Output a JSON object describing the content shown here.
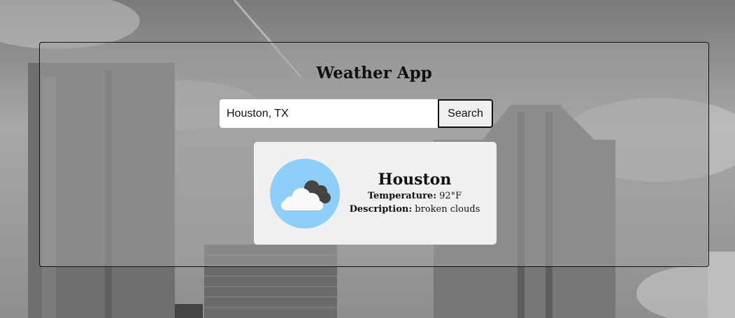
{
  "app": {
    "title": "Weather App"
  },
  "search": {
    "value": "Houston, TX",
    "button_label": "Search"
  },
  "weather": {
    "icon": "broken-clouds-icon",
    "city": "Houston",
    "temperature_label": "Temperature:",
    "temperature_value": "92°F",
    "description_label": "Description:",
    "description_value": "broken clouds"
  },
  "colors": {
    "icon_background": "#8ecffa",
    "card_background": "#f0f0f0"
  }
}
